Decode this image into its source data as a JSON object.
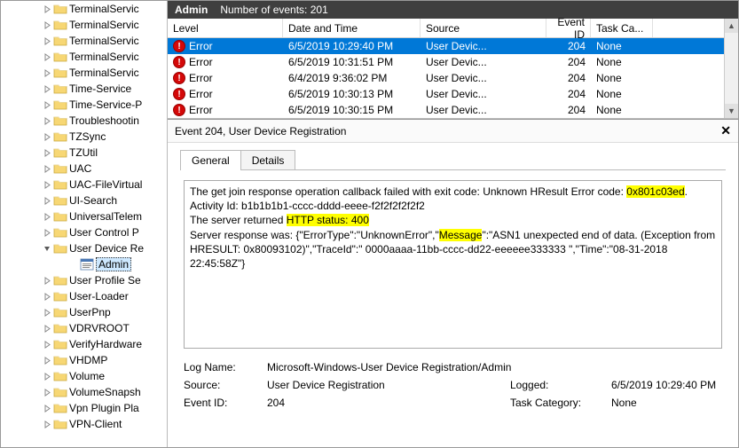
{
  "header": {
    "title": "Admin",
    "count_label": "Number of events: 201"
  },
  "tree": {
    "indent0": 45,
    "indent1": 60,
    "indent2": 75,
    "items": [
      {
        "label": "TerminalServic",
        "indent": 0,
        "expanded": false,
        "icon": "folder"
      },
      {
        "label": "TerminalServic",
        "indent": 0,
        "expanded": false,
        "icon": "folder"
      },
      {
        "label": "TerminalServic",
        "indent": 0,
        "expanded": false,
        "icon": "folder"
      },
      {
        "label": "TerminalServic",
        "indent": 0,
        "expanded": false,
        "icon": "folder"
      },
      {
        "label": "TerminalServic",
        "indent": 0,
        "expanded": false,
        "icon": "folder"
      },
      {
        "label": "Time-Service",
        "indent": 0,
        "expanded": false,
        "icon": "folder"
      },
      {
        "label": "Time-Service-P",
        "indent": 0,
        "expanded": false,
        "icon": "folder"
      },
      {
        "label": "Troubleshootin",
        "indent": 0,
        "expanded": false,
        "icon": "folder"
      },
      {
        "label": "TZSync",
        "indent": 0,
        "expanded": false,
        "icon": "folder"
      },
      {
        "label": "TZUtil",
        "indent": 0,
        "expanded": false,
        "icon": "folder"
      },
      {
        "label": "UAC",
        "indent": 0,
        "expanded": false,
        "icon": "folder"
      },
      {
        "label": "UAC-FileVirtual",
        "indent": 0,
        "expanded": false,
        "icon": "folder"
      },
      {
        "label": "UI-Search",
        "indent": 0,
        "expanded": false,
        "icon": "folder"
      },
      {
        "label": "UniversalTelem",
        "indent": 0,
        "expanded": false,
        "icon": "folder"
      },
      {
        "label": "User Control P",
        "indent": 0,
        "expanded": false,
        "icon": "folder"
      },
      {
        "label": "User Device Re",
        "indent": 0,
        "expanded": true,
        "icon": "folder"
      },
      {
        "label": "Admin",
        "indent": 2,
        "expanded": null,
        "icon": "log",
        "selected": true
      },
      {
        "label": "User Profile Se",
        "indent": 0,
        "expanded": false,
        "icon": "folder"
      },
      {
        "label": "User-Loader",
        "indent": 0,
        "expanded": false,
        "icon": "folder"
      },
      {
        "label": "UserPnp",
        "indent": 0,
        "expanded": false,
        "icon": "folder"
      },
      {
        "label": "VDRVROOT",
        "indent": 0,
        "expanded": false,
        "icon": "folder"
      },
      {
        "label": "VerifyHardware",
        "indent": 0,
        "expanded": false,
        "icon": "folder"
      },
      {
        "label": "VHDMP",
        "indent": 0,
        "expanded": false,
        "icon": "folder"
      },
      {
        "label": "Volume",
        "indent": 0,
        "expanded": false,
        "icon": "folder"
      },
      {
        "label": "VolumeSnapsh",
        "indent": 0,
        "expanded": false,
        "icon": "folder"
      },
      {
        "label": "Vpn Plugin Pla",
        "indent": 0,
        "expanded": false,
        "icon": "folder"
      },
      {
        "label": "VPN-Client",
        "indent": 0,
        "expanded": false,
        "icon": "folder"
      }
    ]
  },
  "grid": {
    "columns": {
      "level": "Level",
      "date": "Date and Time",
      "source": "Source",
      "event_id": "Event ID",
      "task": "Task Ca..."
    },
    "rows": [
      {
        "level": "Error",
        "date": "6/5/2019 10:29:40 PM",
        "source": "User Devic...",
        "event_id": "204",
        "task": "None",
        "selected": true
      },
      {
        "level": "Error",
        "date": "6/5/2019 10:31:51 PM",
        "source": "User Devic...",
        "event_id": "204",
        "task": "None"
      },
      {
        "level": "Error",
        "date": "6/4/2019 9:36:02 PM",
        "source": "User Devic...",
        "event_id": "204",
        "task": "None"
      },
      {
        "level": "Error",
        "date": "6/5/2019 10:30:13 PM",
        "source": "User Devic...",
        "event_id": "204",
        "task": "None"
      },
      {
        "level": "Error",
        "date": "6/5/2019 10:30:15 PM",
        "source": "User Devic...",
        "event_id": "204",
        "task": "None"
      }
    ]
  },
  "detail": {
    "title": "Event 204, User Device Registration",
    "tabs": {
      "general": "General",
      "details": "Details"
    },
    "message": {
      "l1a": "The get join response operation callback failed with exit code: Unknown HResult Error code: ",
      "l1h": "0x801c03ed",
      "l1b": ".",
      "l2": "Activity Id: b1b1b1b1-cccc-dddd-eeee-f2f2f2f2f2f2",
      "l3a": "The server returned ",
      "l3h": "HTTP status: 400",
      "l4a": "Server response was: {\"ErrorType\":\"UnknownError\",\"",
      "l4h": "Message",
      "l4b": "\":\"ASN1 unexpected end of data. (Exception from HRESULT: 0x80093102)\",\"TraceId\":\" 0000aaaa-11bb-cccc-dd22-eeeeee333333 \",\"Time\":\"08-31-2018 22:45:58Z\"}"
    },
    "props": {
      "log_name_l": "Log Name:",
      "log_name_v": "Microsoft-Windows-User Device Registration/Admin",
      "source_l": "Source:",
      "source_v": "User Device Registration",
      "logged_l": "Logged:",
      "logged_v": "6/5/2019 10:29:40 PM",
      "event_id_l": "Event ID:",
      "event_id_v": "204",
      "task_cat_l": "Task Category:",
      "task_cat_v": "None"
    }
  }
}
